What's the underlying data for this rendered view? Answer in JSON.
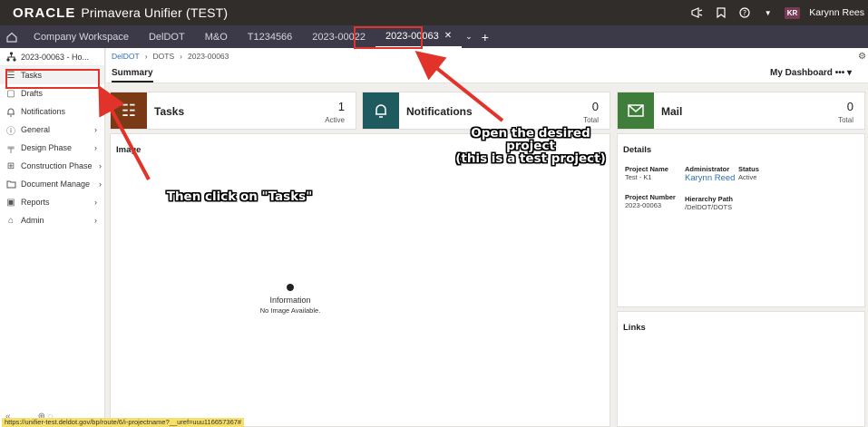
{
  "header": {
    "brand_oracle": "ORACLE",
    "brand_product": "Primavera Unifier (TEST)",
    "user_initials": "KR",
    "user_name": "Karynn Rees",
    "icons": [
      "megaphone-icon",
      "bookmark-icon",
      "help-icon",
      "chevron-down-icon"
    ]
  },
  "tabs": [
    {
      "label": "Company Workspace"
    },
    {
      "label": "DelDOT"
    },
    {
      "label": "M&O"
    },
    {
      "label": "T1234566"
    },
    {
      "label": "2023-00022"
    },
    {
      "label": "2023-00063"
    }
  ],
  "sidebar": {
    "project": "2023-00063 - Ho...",
    "items": [
      {
        "label": "Tasks",
        "icon": "tasks-icon"
      },
      {
        "label": "Drafts",
        "icon": "drafts-icon"
      },
      {
        "label": "Notifications",
        "icon": "bell-icon"
      },
      {
        "label": "General",
        "icon": "info-icon"
      },
      {
        "label": "Design Phase",
        "icon": "design-icon"
      },
      {
        "label": "Construction Phase",
        "icon": "construction-icon"
      },
      {
        "label": "Document Manager",
        "icon": "folder-icon"
      },
      {
        "label": "Reports",
        "icon": "reports-icon"
      },
      {
        "label": "Admin",
        "icon": "admin-icon"
      }
    ]
  },
  "breadcrumb": [
    "DelDOT",
    "DOTS",
    "2023-00063"
  ],
  "summary_tab": "Summary",
  "dashboard_label": "My Dashboard",
  "cards": {
    "tasks": {
      "title": "Tasks",
      "count": "1",
      "sub": "Active",
      "color": "#7b3a16"
    },
    "notifications": {
      "title": "Notifications",
      "count": "0",
      "sub": "Total",
      "color": "#1e5a5e"
    },
    "mail": {
      "title": "Mail",
      "count": "0",
      "sub": "Total",
      "color": "#3f7d3b"
    }
  },
  "image_panel": {
    "title": "Image",
    "info_title": "Information",
    "info_sub": "No Image Available."
  },
  "details": {
    "title": "Details",
    "project_name_label": "Project Name",
    "project_name": "Test - K1",
    "administrator_label": "Administrator",
    "administrator": "Karynn Reed",
    "status_label": "Status",
    "status": "Active",
    "project_number_label": "Project Number",
    "project_number": "2023-00063",
    "hierarchy_label": "Hierarchy Path",
    "hierarchy": "/DelDOT/DOTS"
  },
  "links_title": "Links",
  "status_url": "https://unifier-test.deldot.gov/bp/route/6/i-projectname?__uref=uuu116657367#",
  "annotations": {
    "open_project": "Open the desired project\n(this is a test project)",
    "click_tasks": "Then click on \"Tasks\""
  }
}
